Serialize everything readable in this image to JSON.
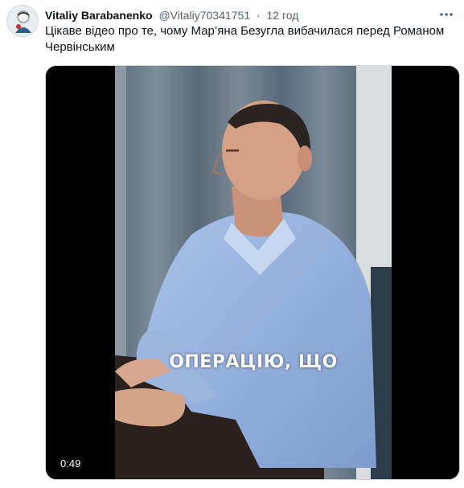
{
  "tweet": {
    "author_name": "Vitaliy Barabanenko",
    "author_handle": "@Vitaliy70341751",
    "separator": "·",
    "timestamp": "12 год",
    "text": "Цікаве відео про те, чому Мар’яна Безугла вибачилася перед Романом Червінським"
  },
  "media": {
    "caption": "ОПЕРАЦІЮ, ЩО",
    "duration": "0:49"
  },
  "icons": {
    "more": "more-horizontal-icon",
    "avatar": "user-avatar"
  }
}
